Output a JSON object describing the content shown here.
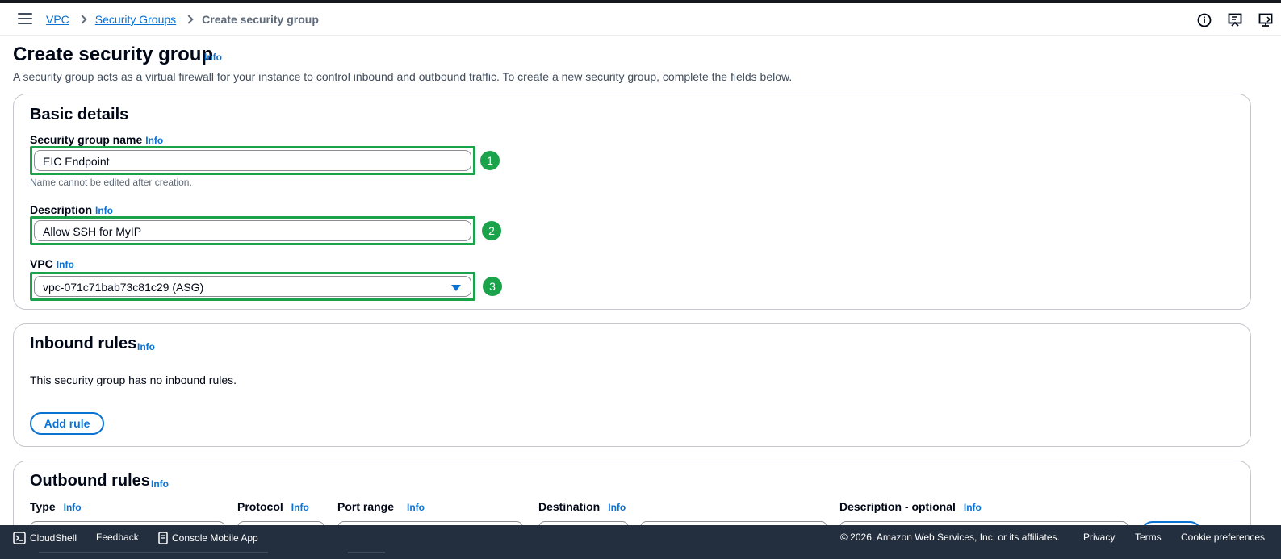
{
  "breadcrumb": {
    "vpc": "VPC",
    "security_groups": "Security Groups",
    "current": "Create security group"
  },
  "page": {
    "title": "Create security group",
    "info": "Info",
    "description": "A security group acts as a virtual firewall for your instance to control inbound and outbound traffic. To create a new security group, complete the fields below."
  },
  "basic": {
    "heading": "Basic details",
    "name_label": "Security group name",
    "name_info": "Info",
    "name_value": "EIC Endpoint",
    "name_hint": "Name cannot be edited after creation.",
    "desc_label": "Description",
    "desc_info": "Info",
    "desc_value": "Allow SSH for MyIP",
    "vpc_label": "VPC",
    "vpc_info": "Info",
    "vpc_value": "vpc-071c71bab73c81c29 (ASG)",
    "badges": [
      "1",
      "2",
      "3"
    ]
  },
  "inbound": {
    "heading": "Inbound rules",
    "info": "Info",
    "empty": "This security group has no inbound rules.",
    "add_rule": "Add rule"
  },
  "outbound": {
    "heading": "Outbound rules",
    "info": "Info",
    "columns": [
      {
        "label": "Type",
        "info": "Info"
      },
      {
        "label": "Protocol",
        "info": "Info"
      },
      {
        "label": "Port range",
        "info": "Info"
      },
      {
        "label": "Destination",
        "info": "Info"
      },
      {
        "label": "Description - optional",
        "info": "Info"
      }
    ]
  },
  "footer": {
    "cloudshell": "CloudShell",
    "feedback": "Feedback",
    "mobile": "Console Mobile App",
    "copyright": "© 2026, Amazon Web Services, Inc. or its affiliates.",
    "privacy": "Privacy",
    "terms": "Terms",
    "cookies": "Cookie preferences"
  },
  "colors": {
    "accent": "#0972d3",
    "highlight": "#1aa34a",
    "footer_bg": "#232f3e"
  }
}
